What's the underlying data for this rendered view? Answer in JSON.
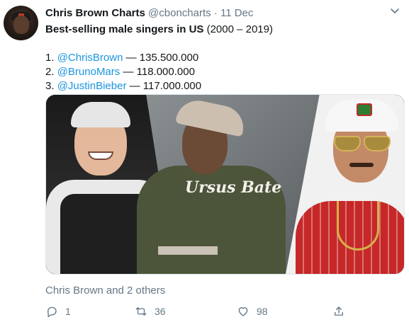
{
  "tweet": {
    "author_name": "Chris Brown Charts",
    "author_handle": "@cboncharts",
    "separator": "·",
    "date": "11 Dec",
    "headline_bold": "Best-selling male singers in US",
    "headline_rest": " (2000 – 2019)",
    "ranking": [
      {
        "prefix": "1. ",
        "mention": "@ChrisBrown",
        "suffix": " — 135.500.000"
      },
      {
        "prefix": "2. ",
        "mention": "@BrunoMars",
        "suffix": " — 118.000.000"
      },
      {
        "prefix": "3. ",
        "mention": "@JustinBieber",
        "suffix": " — 117.000.000"
      }
    ],
    "photo_caption": "Ursus Bate",
    "social_context": "Chris Brown and 2 others"
  },
  "actions": {
    "reply_count": "1",
    "retweet_count": "36",
    "like_count": "98"
  },
  "colors": {
    "link": "#1b95e0",
    "secondary": "#657786",
    "text": "#14171a"
  },
  "icons": [
    "avatar",
    "chevron-down-icon",
    "reply-icon",
    "retweet-icon",
    "like-icon",
    "share-icon"
  ]
}
